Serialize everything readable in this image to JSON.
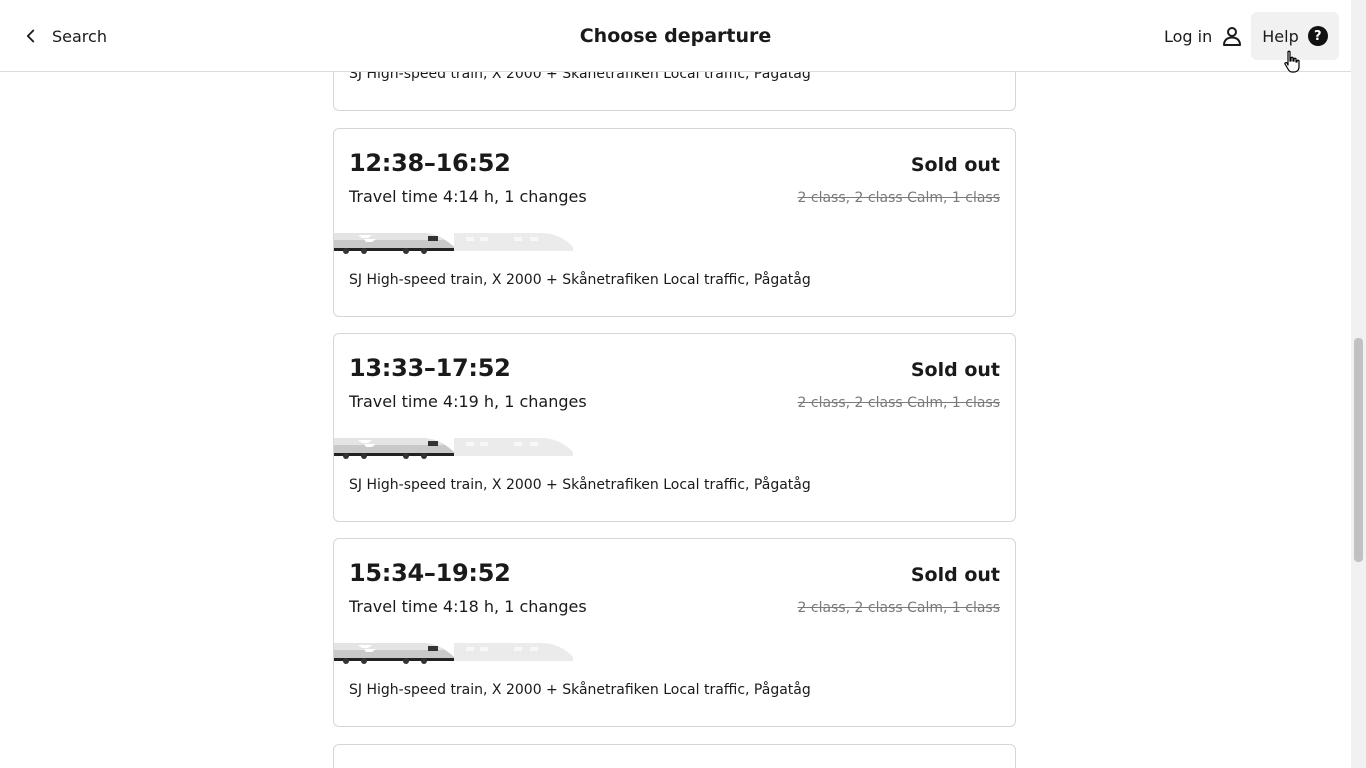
{
  "header": {
    "back_label": "Search",
    "title": "Choose departure",
    "login_label": "Log in",
    "help_label": "Help",
    "help_symbol": "?"
  },
  "departures": [
    {
      "operator": "SJ High-speed train, X 2000 + Skånetrafiken Local traffic, Pågatåg"
    },
    {
      "time": "12:38–16:52",
      "travel": "Travel time 4:14 h, 1 changes",
      "status": "Sold out",
      "classes": "2 class, 2 class Calm, 1 class",
      "operator": "SJ High-speed train, X 2000 + Skånetrafiken Local traffic, Pågatåg"
    },
    {
      "time": "13:33–17:52",
      "travel": "Travel time 4:19 h, 1 changes",
      "status": "Sold out",
      "classes": "2 class, 2 class Calm, 1 class",
      "operator": "SJ High-speed train, X 2000 + Skånetrafiken Local traffic, Pågatåg"
    },
    {
      "time": "15:34–19:52",
      "travel": "Travel time 4:18 h, 1 changes",
      "status": "Sold out",
      "classes": "2 class, 2 class Calm, 1 class",
      "operator": "SJ High-speed train, X 2000 + Skånetrafiken Local traffic, Pågatåg"
    }
  ],
  "colors": {
    "border": "#d6d6d6",
    "muted_text": "#7a7a7a",
    "help_bg": "#f1f1f1"
  }
}
